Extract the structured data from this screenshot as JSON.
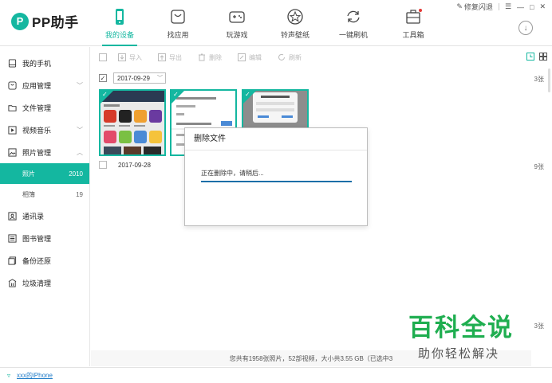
{
  "app": {
    "logo_letter": "P",
    "logo_text": "PP助手"
  },
  "nav": [
    {
      "label": "我的设备",
      "icon": "phone-icon",
      "active": true
    },
    {
      "label": "找应用",
      "icon": "shopping-bag-icon",
      "active": false
    },
    {
      "label": "玩游戏",
      "icon": "gamepad-icon",
      "active": false
    },
    {
      "label": "铃声壁纸",
      "icon": "star-icon",
      "active": false
    },
    {
      "label": "一键刷机",
      "icon": "refresh-icon",
      "active": false
    },
    {
      "label": "工具箱",
      "icon": "toolbox-icon",
      "active": false
    }
  ],
  "window": {
    "fix_label": "修复闪退",
    "menu_glyph": "☰",
    "min_glyph": "—",
    "max_glyph": "□",
    "close_glyph": "✕",
    "download_glyph": "↓"
  },
  "sidebar": {
    "items": [
      {
        "label": "我的手机",
        "icon": "device-icon"
      },
      {
        "label": "应用管理",
        "icon": "app-icon",
        "chevron": "﹀"
      },
      {
        "label": "文件管理",
        "icon": "folder-icon"
      },
      {
        "label": "视频音乐",
        "icon": "play-icon",
        "chevron": "﹀"
      },
      {
        "label": "照片管理",
        "icon": "photo-icon",
        "chevron": "︿"
      },
      {
        "label": "通讯录",
        "icon": "contacts-icon"
      },
      {
        "label": "图书管理",
        "icon": "book-icon"
      },
      {
        "label": "备份还原",
        "icon": "backup-icon"
      },
      {
        "label": "垃圾清理",
        "icon": "trash-icon"
      }
    ],
    "sub": [
      {
        "label": "照片",
        "count": "2010",
        "active": true
      },
      {
        "label": "相簿",
        "count": "19",
        "active": false
      }
    ]
  },
  "toolbar": {
    "import": "导入",
    "export": "导出",
    "delete": "删除",
    "edit": "编辑",
    "refresh": "刷新"
  },
  "groups": [
    {
      "date": "2017-09-29",
      "count": "3张",
      "checked": "✓",
      "dropdown": "﹀"
    },
    {
      "date": "2017-09-28",
      "count": "9张"
    },
    {
      "count": "3张"
    }
  ],
  "dialog": {
    "title": "删除文件",
    "message": "正在删除中，请稍后...",
    "progress": 1.0
  },
  "status": {
    "text": "您共有1958张照片，52部视频，大小共3.55 GB（已选中3"
  },
  "footer": {
    "device": "xxx的iPhone",
    "device_icon": "▿"
  },
  "watermark": {
    "main": "百科全说",
    "sub": "助你轻松解决"
  },
  "colors": {
    "accent": "#14b7a0",
    "progress": "#1c6fa8",
    "watermark": "#1fae50"
  }
}
